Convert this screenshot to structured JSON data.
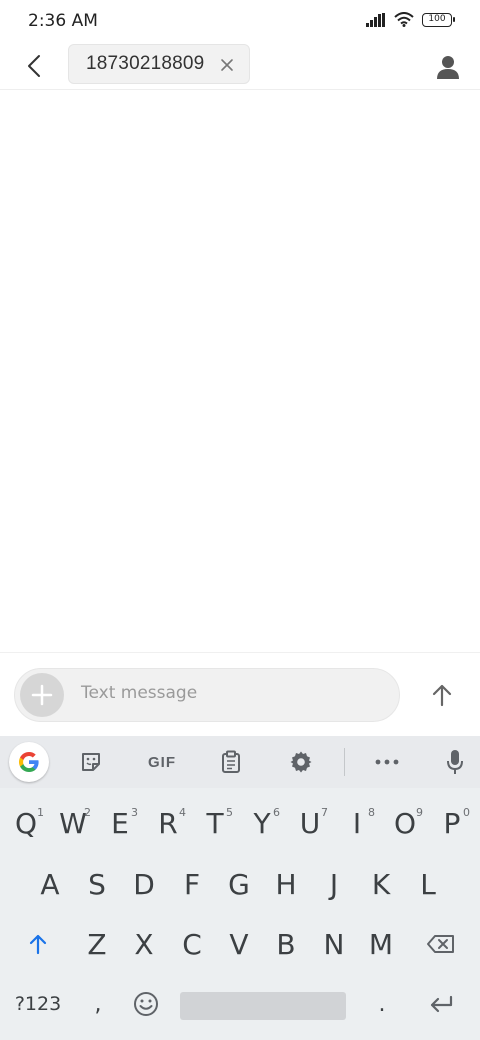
{
  "status_bar": {
    "time": "2:36 AM",
    "battery": "100"
  },
  "header": {
    "recipient": "18730218809"
  },
  "composer": {
    "placeholder": "Text message"
  },
  "keyboard": {
    "toolbar": {
      "gif_label": "GIF"
    },
    "row1": [
      {
        "key": "Q",
        "hint": "1"
      },
      {
        "key": "W",
        "hint": "2"
      },
      {
        "key": "E",
        "hint": "3"
      },
      {
        "key": "R",
        "hint": "4"
      },
      {
        "key": "T",
        "hint": "5"
      },
      {
        "key": "Y",
        "hint": "6"
      },
      {
        "key": "U",
        "hint": "7"
      },
      {
        "key": "I",
        "hint": "8"
      },
      {
        "key": "O",
        "hint": "9"
      },
      {
        "key": "P",
        "hint": "0"
      }
    ],
    "row2": [
      "A",
      "S",
      "D",
      "F",
      "G",
      "H",
      "J",
      "K",
      "L"
    ],
    "row3": [
      "Z",
      "X",
      "C",
      "V",
      "B",
      "N",
      "M"
    ],
    "symbols_label": "?123",
    "comma": ",",
    "period": "."
  },
  "colors": {
    "accent": "#1a73e8",
    "shift_active": "#1a73e8"
  }
}
